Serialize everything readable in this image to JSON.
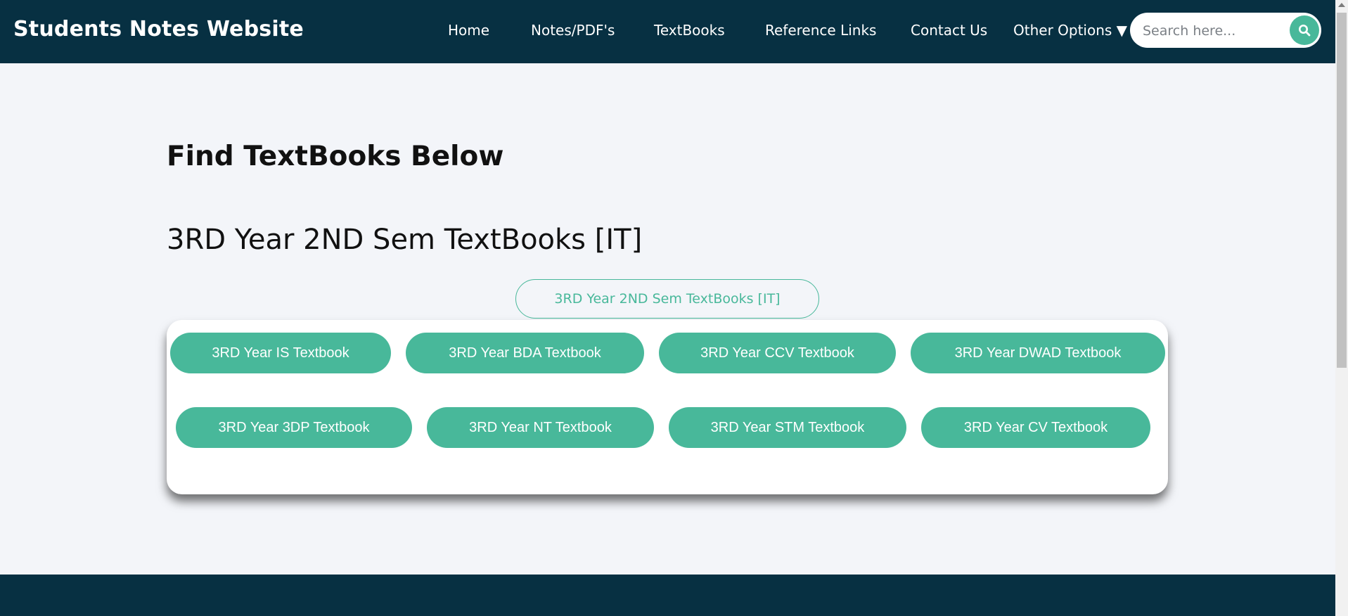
{
  "header": {
    "brand": "Students Notes Website",
    "nav": [
      {
        "label": "Home"
      },
      {
        "label": "Notes/PDF's"
      },
      {
        "label": "TextBooks"
      },
      {
        "label": "Reference Links"
      },
      {
        "label": "Contact Us"
      },
      {
        "label": "Other Options ▼"
      }
    ],
    "search": {
      "placeholder": "Search here...",
      "value": "",
      "icon": "search-icon"
    }
  },
  "main": {
    "title": "Find TextBooks Below",
    "section_title": "3RD Year 2ND Sem TextBooks [IT]",
    "tab_label": "3RD Year 2ND Sem TextBooks [IT]",
    "books": [
      {
        "label": "3RD Year IS Textbook"
      },
      {
        "label": "3RD Year BDA Textbook"
      },
      {
        "label": "3RD Year CCV Textbook"
      },
      {
        "label": "3RD Year DWAD Textbook"
      },
      {
        "label": "3RD Year 3DP Textbook"
      },
      {
        "label": "3RD Year NT Textbook"
      },
      {
        "label": "3RD Year STM Textbook"
      },
      {
        "label": "3RD Year CV Textbook"
      }
    ]
  },
  "colors": {
    "navbar": "#073042",
    "accent": "#48b89a",
    "background": "#f3f5f9"
  }
}
